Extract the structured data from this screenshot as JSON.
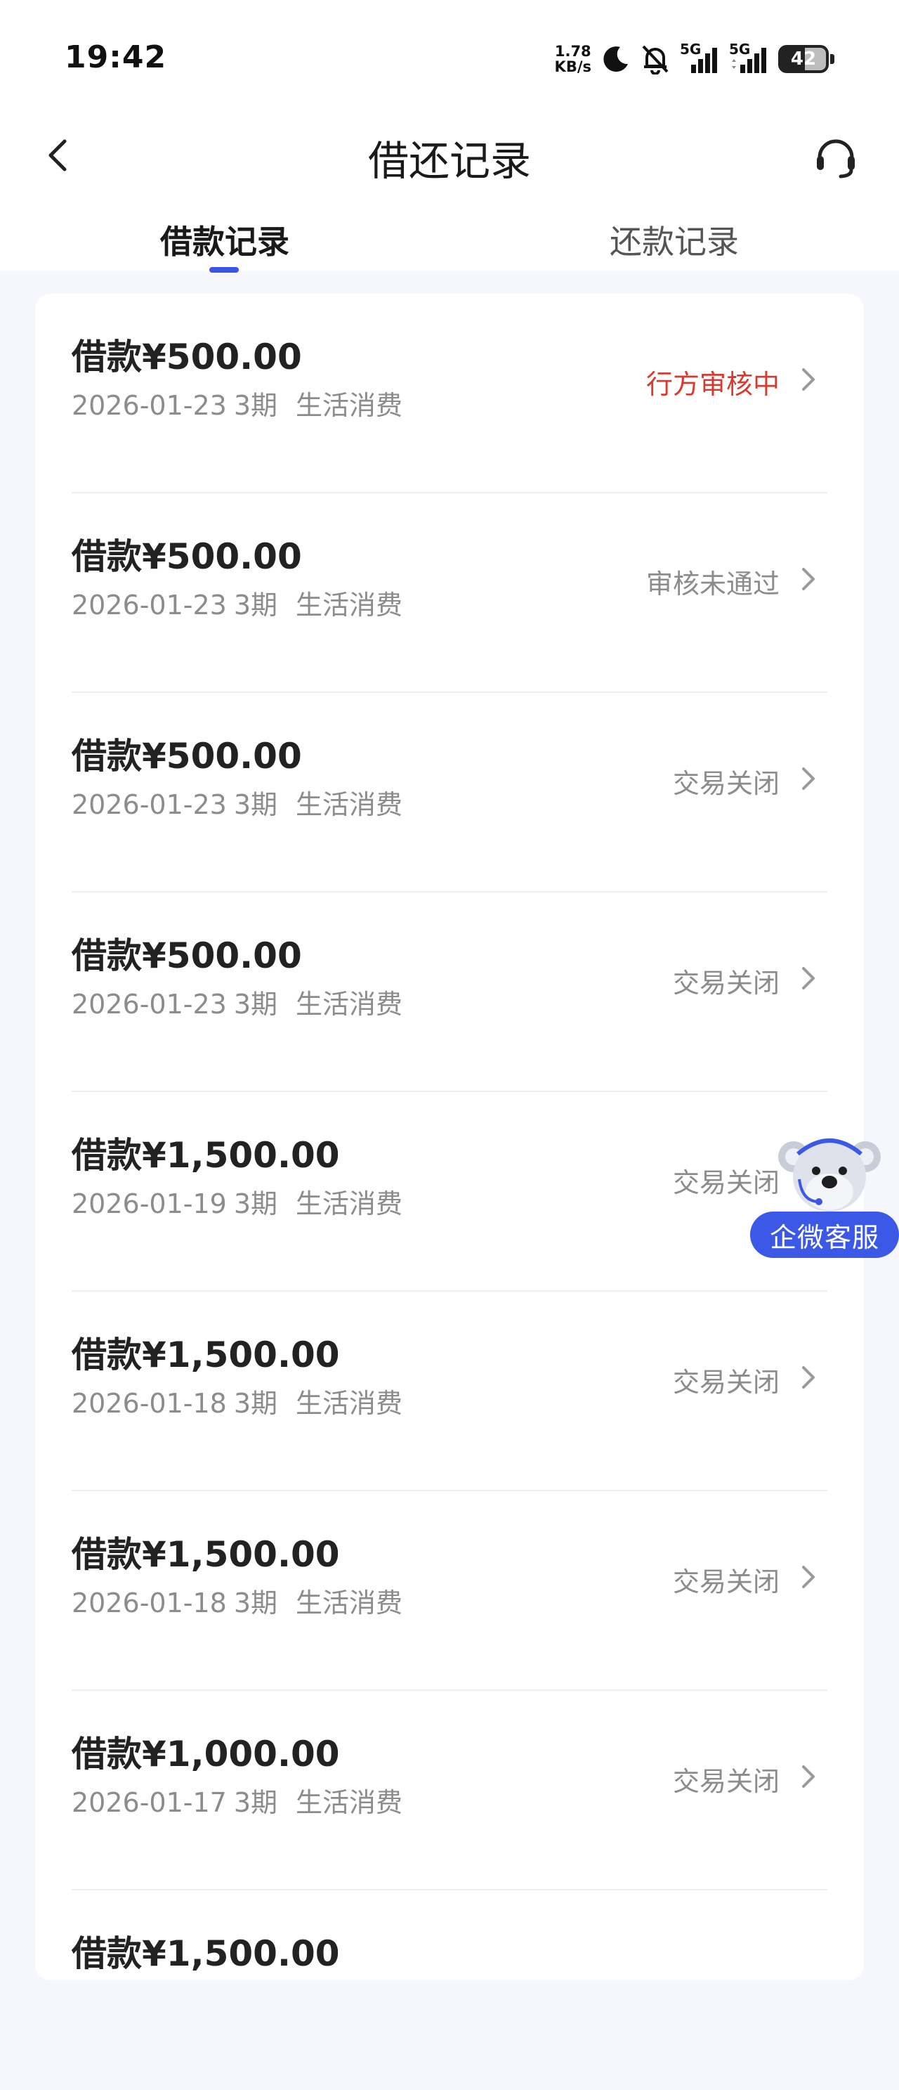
{
  "status_bar": {
    "time": "19:42",
    "net_speed_value": "1.78",
    "net_speed_unit": "KB/s",
    "signal1_label": "5G",
    "signal2_label": "5G",
    "battery_level": "42"
  },
  "nav": {
    "title": "借还记录",
    "back_icon": "chevron-left-icon",
    "support_icon": "headset-icon"
  },
  "tabs": [
    {
      "label": "借款记录",
      "active": true
    },
    {
      "label": "还款记录",
      "active": false
    }
  ],
  "records": [
    {
      "prefix": "借款",
      "amount": "¥500.00",
      "date": "2026-01-23",
      "term": "3期",
      "purpose": "生活消费",
      "status": "行方审核中",
      "status_color": "#d93a2f"
    },
    {
      "prefix": "借款",
      "amount": "¥500.00",
      "date": "2026-01-23",
      "term": "3期",
      "purpose": "生活消费",
      "status": "审核未通过",
      "status_color": "#8c8c8c"
    },
    {
      "prefix": "借款",
      "amount": "¥500.00",
      "date": "2026-01-23",
      "term": "3期",
      "purpose": "生活消费",
      "status": "交易关闭",
      "status_color": "#8c8c8c"
    },
    {
      "prefix": "借款",
      "amount": "¥500.00",
      "date": "2026-01-23",
      "term": "3期",
      "purpose": "生活消费",
      "status": "交易关闭",
      "status_color": "#8c8c8c"
    },
    {
      "prefix": "借款",
      "amount": "¥1,500.00",
      "date": "2026-01-19",
      "term": "3期",
      "purpose": "生活消费",
      "status": "交易关闭",
      "status_color": "#8c8c8c"
    },
    {
      "prefix": "借款",
      "amount": "¥1,500.00",
      "date": "2026-01-18",
      "term": "3期",
      "purpose": "生活消费",
      "status": "交易关闭",
      "status_color": "#8c8c8c"
    },
    {
      "prefix": "借款",
      "amount": "¥1,500.00",
      "date": "2026-01-18",
      "term": "3期",
      "purpose": "生活消费",
      "status": "交易关闭",
      "status_color": "#8c8c8c"
    },
    {
      "prefix": "借款",
      "amount": "¥1,000.00",
      "date": "2026-01-17",
      "term": "3期",
      "purpose": "生活消费",
      "status": "交易关闭",
      "status_color": "#8c8c8c"
    },
    {
      "prefix": "借款",
      "amount": "¥1,500.00",
      "date": "",
      "term": "",
      "purpose": "",
      "status": "",
      "status_color": "#8c8c8c"
    }
  ],
  "floating_service": {
    "label": "企微客服",
    "icon": "koala-mascot-icon",
    "color": "#3b58e6"
  },
  "colors": {
    "accent": "#3a56e0",
    "pending": "#d93a2f",
    "muted": "#8c8c8c",
    "background": "#f5f7fd"
  }
}
